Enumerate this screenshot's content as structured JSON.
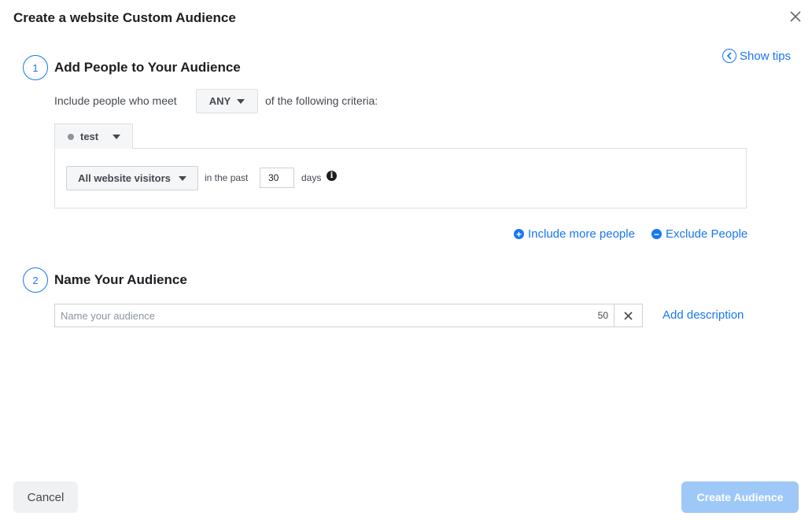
{
  "dialog": {
    "title": "Create a website Custom Audience",
    "show_tips": "Show tips"
  },
  "step1": {
    "number": "1",
    "title": "Add People to Your Audience",
    "include_prefix": "Include people who meet",
    "match_value": "ANY",
    "include_suffix": "of the following criteria:",
    "rule_tab": "test",
    "source": "All website visitors",
    "in_the_past": "in the past",
    "days_value": "30",
    "days_label": "days",
    "include_more": "Include more people",
    "exclude": "Exclude People"
  },
  "step2": {
    "number": "2",
    "title": "Name Your Audience",
    "name_placeholder": "Name your audience",
    "name_value": "",
    "char_count": "50",
    "add_description": "Add description"
  },
  "footer": {
    "cancel": "Cancel",
    "create": "Create Audience"
  },
  "colors": {
    "accent": "#1877f2",
    "create_disabled": "#9ec8f8"
  },
  "icons": {
    "close": "close-icon",
    "tips": "chevron-left-icon",
    "info": "info-icon",
    "plus": "plus-circle-icon",
    "minus": "minus-circle-icon"
  }
}
